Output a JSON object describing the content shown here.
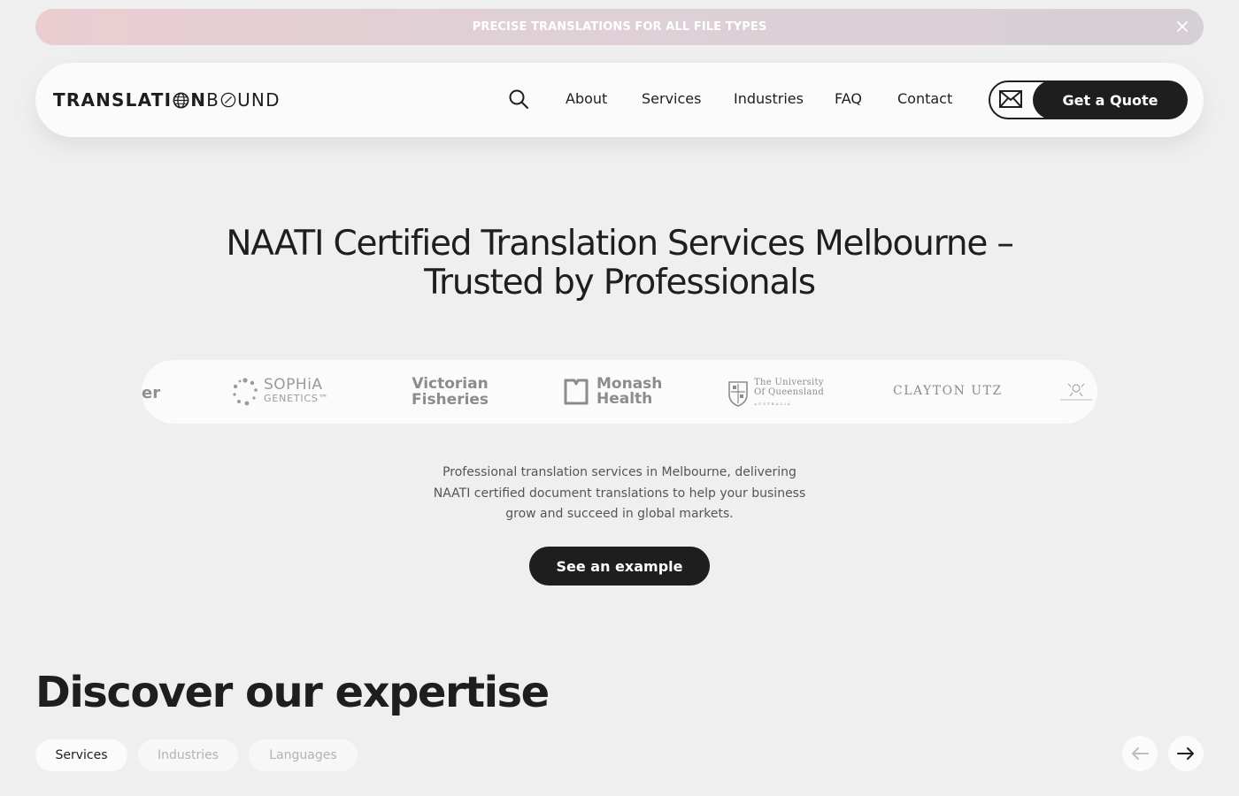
{
  "banner": {
    "text": "PRECISE TRANSLATIONS FOR ALL FILE TYPES",
    "close_icon": "close-icon"
  },
  "header": {
    "logo": {
      "part1": "TRANSLATI",
      "part2": "N",
      "part3": "B",
      "part4": "UND"
    },
    "nav": [
      "About",
      "Services",
      "Industries",
      "FAQ",
      "Contact"
    ],
    "cta": {
      "quote_label": "Get a Quote",
      "mail_icon": "envelope-icon",
      "search_icon": "search-icon"
    }
  },
  "hero": {
    "title_line1": "NAATI Certified Translation Services Melbourne –",
    "title_line2": "Trusted by Professionals"
  },
  "client_logos": {
    "partial_left": "er",
    "sophia": {
      "line1": "SOPHiA",
      "line2": "GENETICS™"
    },
    "victorian": {
      "line1": "Victorian",
      "line2": "Fisheries"
    },
    "monash": {
      "line1": "Monash",
      "line2": "Health"
    },
    "uq": {
      "line1": "The University",
      "line2": "Of Queensland",
      "line3": "AUSTRALIA"
    },
    "clayton": "CLAYTON UTZ"
  },
  "intro": {
    "description": "Professional translation services in Melbourne, delivering NAATI certified document translations to help your business grow and succeed in global markets.",
    "example_button": "See an example"
  },
  "expertise": {
    "title": "Discover our expertise",
    "tabs": [
      "Services",
      "Industries",
      "Languages"
    ],
    "active_tab": "Services"
  },
  "colors": {
    "dark": "#1e1e1e",
    "background": "#efefef",
    "surface": "#fbfbfb",
    "banner_start": "#ebcdd1",
    "banner_end": "#d7cfd6"
  }
}
